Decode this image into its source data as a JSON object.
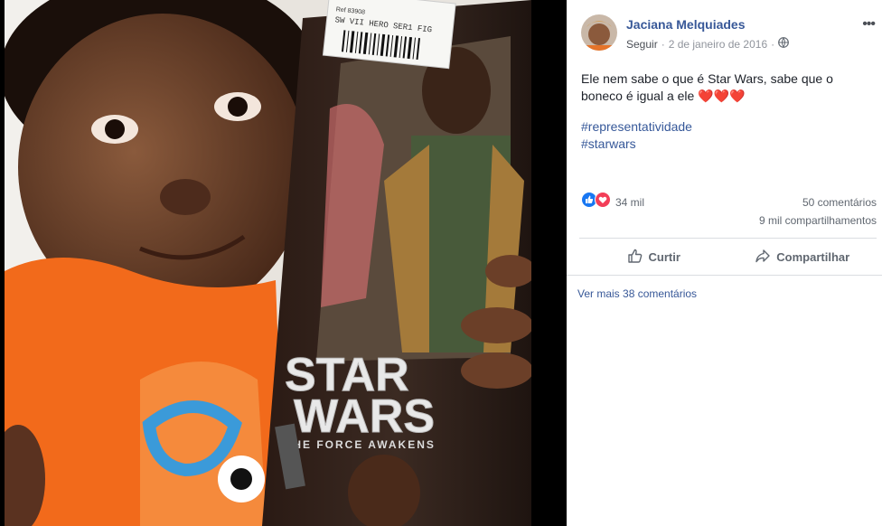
{
  "post": {
    "author": "Jaciana Melquiades",
    "follow_label": "Seguir",
    "separator": "·",
    "date": "2 de janeiro de 2016",
    "text_line1": "Ele nem sabe o que é Star Wars, sabe que o",
    "text_line2": "boneco é igual a ele",
    "hearts": "❤️❤️❤️",
    "hashtags": [
      "#representatividade",
      "#starwars"
    ]
  },
  "stats": {
    "reactions_count": "34 mil",
    "comments": "50 comentários",
    "shares": "9 mil compartilhamentos"
  },
  "actions": {
    "like_label": "Curtir",
    "share_label": "Compartilhar"
  },
  "comments": {
    "view_more": "Ver mais 38 comentários"
  },
  "photo": {
    "price_tag_line1": "Ref 83908",
    "price_tag_line2": "SW VII HERO SER1 FIG",
    "box_title_line1": "STAR",
    "box_title_line2": "WARS",
    "box_subtitle": "THE FORCE AWAKENS"
  },
  "colors": {
    "link": "#385898",
    "like_blue": "#1877f2",
    "love_red": "#f33e58",
    "shirt_orange": "#f26a1b"
  }
}
